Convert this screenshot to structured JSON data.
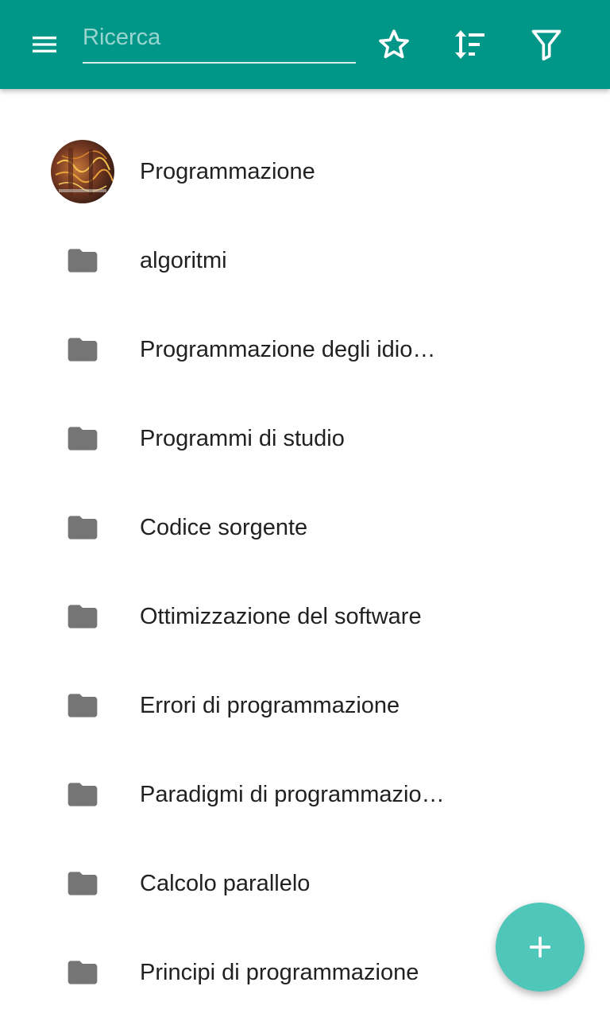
{
  "toolbar": {
    "search_placeholder": "Ricerca",
    "menu_icon": "hamburger-menu-icon",
    "star_icon": "star-outline-icon",
    "sort_icon": "sort-icon",
    "filter_icon": "filter-icon",
    "background_color": "#009688"
  },
  "list": {
    "header_item": {
      "label": "Programmazione",
      "icon": "avatar-image"
    },
    "items": [
      {
        "label": "algoritmi",
        "icon": "folder-icon"
      },
      {
        "label": "Programmazione degli idio…",
        "icon": "folder-icon"
      },
      {
        "label": "Programmi di studio",
        "icon": "folder-icon"
      },
      {
        "label": "Codice sorgente",
        "icon": "folder-icon"
      },
      {
        "label": "Ottimizzazione del software",
        "icon": "folder-icon"
      },
      {
        "label": "Errori di programmazione",
        "icon": "folder-icon"
      },
      {
        "label": "Paradigmi di programmazio…",
        "icon": "folder-icon"
      },
      {
        "label": "Calcolo parallelo",
        "icon": "folder-icon"
      },
      {
        "label": "Principi di programmazione",
        "icon": "folder-icon"
      }
    ]
  },
  "fab": {
    "icon": "plus-icon",
    "color": "#4fc7b8"
  }
}
